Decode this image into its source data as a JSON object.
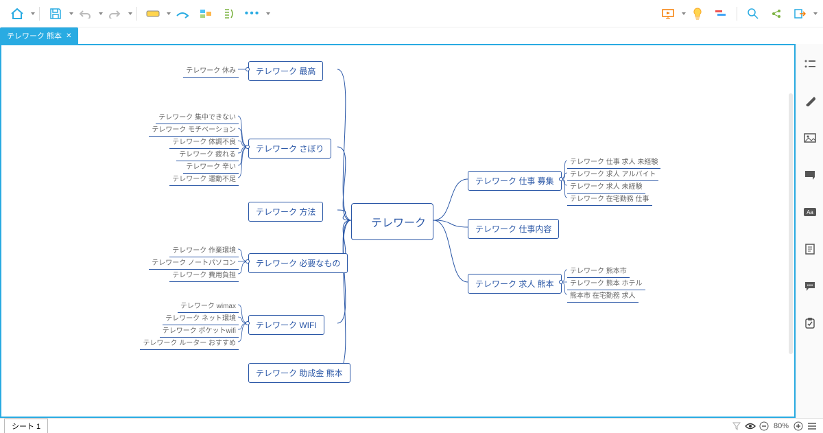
{
  "tab": {
    "title": "テレワーク 熊本",
    "close": "✕"
  },
  "sheet": {
    "label": "シート 1"
  },
  "status": {
    "zoom": "80%"
  },
  "mindmap": {
    "center": "テレワーク",
    "left": [
      {
        "label": "テレワーク 最高",
        "leaves": [
          "テレワーク 休み"
        ]
      },
      {
        "label": "テレワーク さぼり",
        "leaves": [
          "テレワーク 集中できない",
          "テレワーク モチベーション",
          "テレワーク 体調不良",
          "テレワーク 疲れる",
          "テレワーク 辛い",
          "テレワーク 運動不足"
        ]
      },
      {
        "label": "テレワーク 方法",
        "leaves": []
      },
      {
        "label": "テレワーク 必要なもの",
        "leaves": [
          "テレワーク 作業環境",
          "テレワーク ノートパソコン",
          "テレワーク 費用負担"
        ]
      },
      {
        "label": "テレワーク WIFI",
        "leaves": [
          "テレワーク wimax",
          "テレワーク ネット環境",
          "テレワーク ポケットwifi",
          "テレワーク ルーター おすすめ"
        ]
      },
      {
        "label": "テレワーク 助成金 熊本",
        "leaves": []
      }
    ],
    "right": [
      {
        "label": "テレワーク 仕事 募集",
        "leaves": [
          "テレワーク 仕事 求人 未経験",
          "テレワーク 求人 アルバイト",
          "テレワーク 求人 未経験",
          "テレワーク 在宅勤務 仕事"
        ]
      },
      {
        "label": "テレワーク 仕事内容",
        "leaves": []
      },
      {
        "label": "テレワーク 求人 熊本",
        "leaves": [
          "テレワーク 熊本市",
          "テレワーク 熊本 ホテル",
          "熊本市 在宅勤務 求人"
        ]
      }
    ]
  }
}
